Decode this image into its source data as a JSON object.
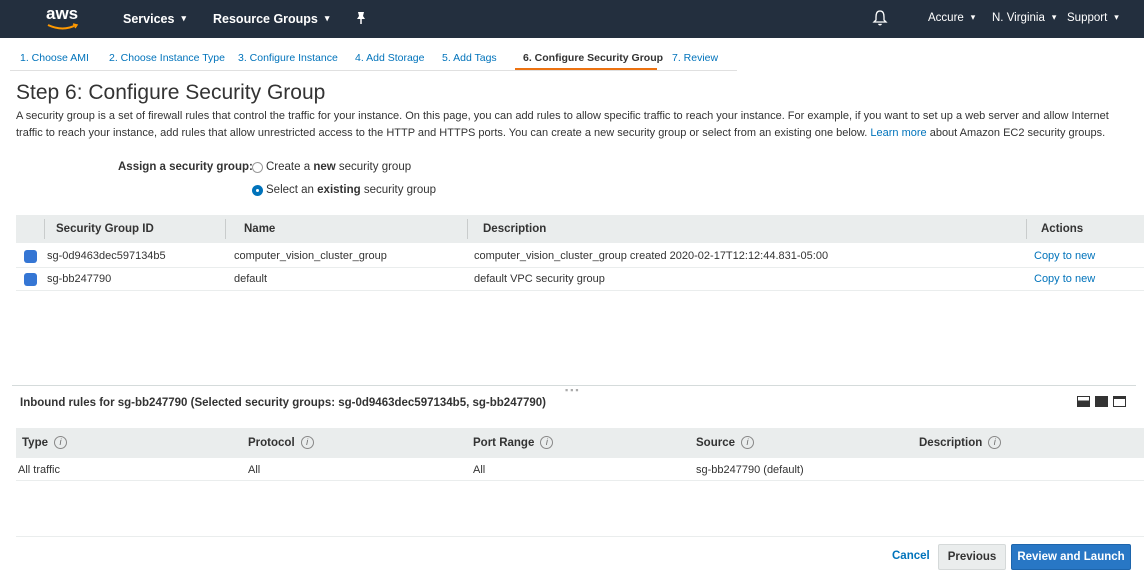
{
  "topnav": {
    "logo": "aws",
    "services": "Services",
    "resource_groups": "Resource Groups",
    "account": "Accure",
    "region": "N. Virginia",
    "support": "Support"
  },
  "tabs": [
    {
      "label": "1. Choose AMI"
    },
    {
      "label": "2. Choose Instance Type"
    },
    {
      "label": "3. Configure Instance"
    },
    {
      "label": "4. Add Storage"
    },
    {
      "label": "5. Add Tags"
    },
    {
      "label": "6. Configure Security Group"
    },
    {
      "label": "7. Review"
    }
  ],
  "page": {
    "title": "Step 6: Configure Security Group",
    "desc_part1": "A security group is a set of firewall rules that control the traffic for your instance. On this page, you can add rules to allow specific traffic to reach your instance. For example, if you want to set up a web server and allow Internet traffic to reach your instance, add rules that allow unrestricted access to the HTTP and HTTPS ports. You can create a new security group or select from an existing one below.",
    "learn_more": "Learn more",
    "desc_part2": "about Amazon EC2 security groups."
  },
  "assign": {
    "label": "Assign a security group:",
    "option_new_pre": "Create a ",
    "option_new_bold": "new",
    "option_new_post": " security group",
    "option_existing_pre": "Select an ",
    "option_existing_bold": "existing",
    "option_existing_post": " security group"
  },
  "sg_table": {
    "headers": {
      "id": "Security Group ID",
      "name": "Name",
      "description": "Description",
      "actions": "Actions"
    },
    "rows": [
      {
        "id": "sg-0d9463dec597134b5",
        "name": "computer_vision_cluster_group",
        "description": "computer_vision_cluster_group created 2020-02-17T12:12:44.831-05:00",
        "action": "Copy to new"
      },
      {
        "id": "sg-bb247790",
        "name": "default",
        "description": "default VPC security group",
        "action": "Copy to new"
      }
    ]
  },
  "inbound": {
    "title": "Inbound rules for sg-bb247790 (Selected security groups: sg-0d9463dec597134b5, sg-bb247790)",
    "headers": {
      "type": "Type",
      "protocol": "Protocol",
      "port_range": "Port Range",
      "source": "Source",
      "description": "Description"
    },
    "info_glyph": "i",
    "rows": [
      {
        "type": "All traffic",
        "protocol": "All",
        "port_range": "All",
        "source": "sg-bb247790 (default)",
        "description": ""
      }
    ]
  },
  "footer": {
    "cancel": "Cancel",
    "previous": "Previous",
    "review_launch": "Review and Launch"
  }
}
